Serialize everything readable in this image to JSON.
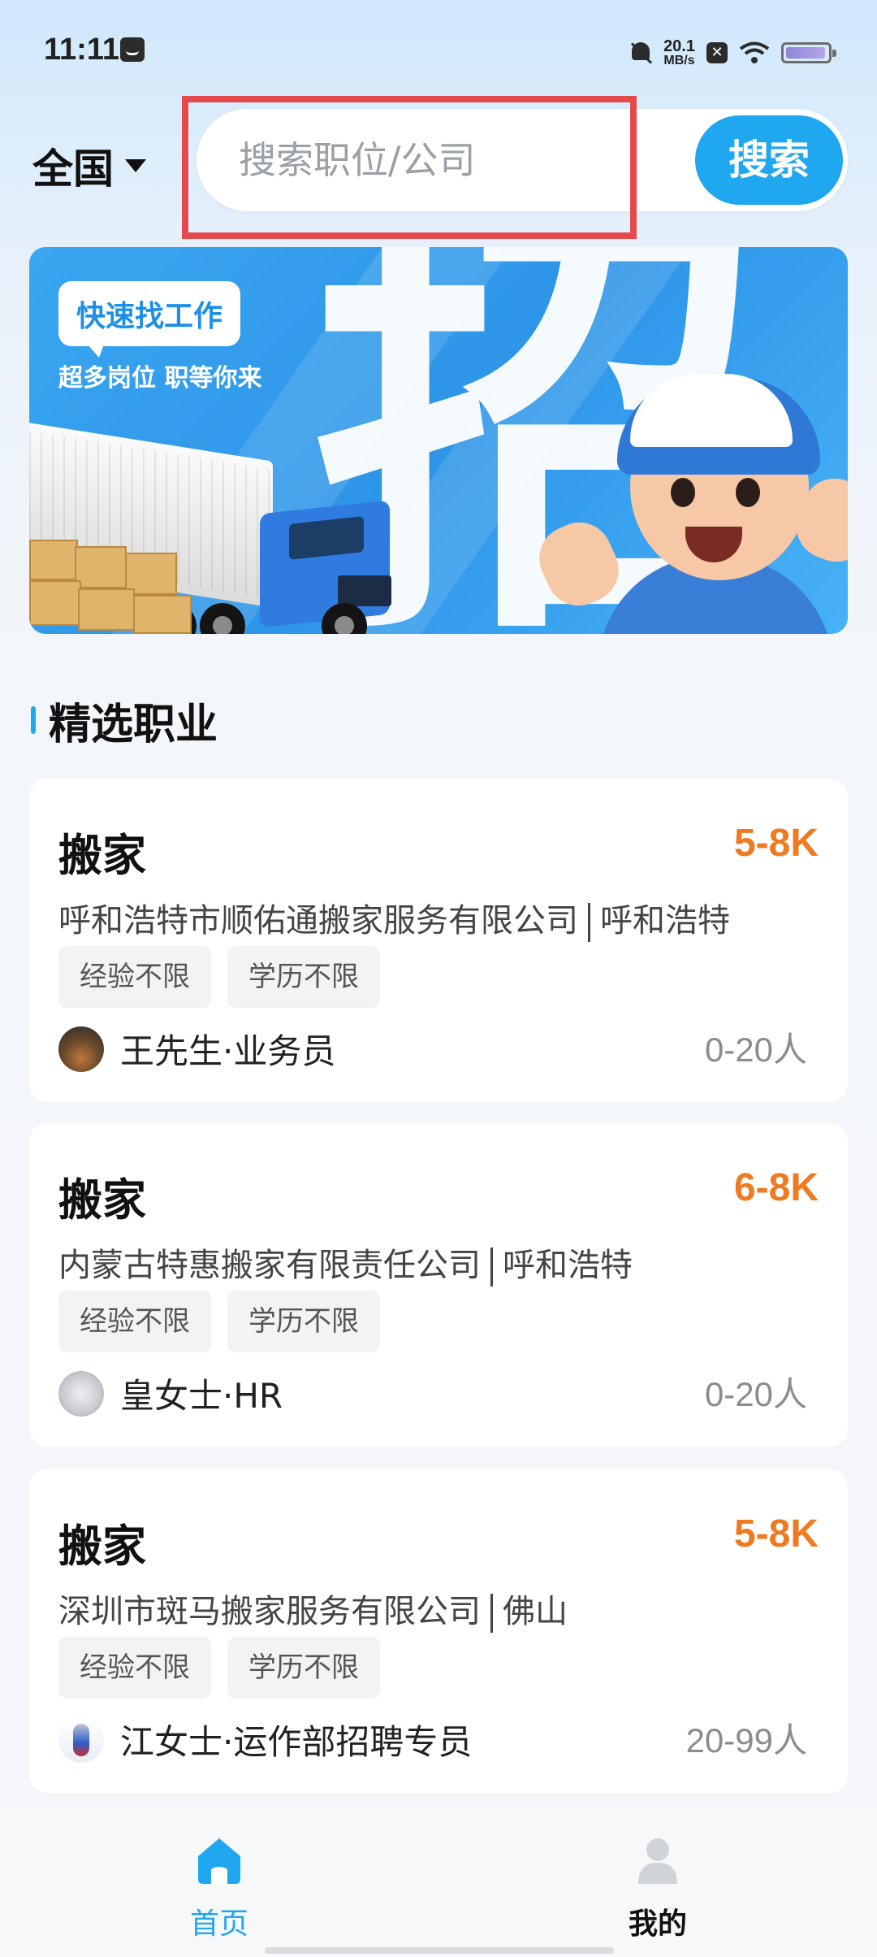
{
  "status_bar": {
    "time": "11:11",
    "net_speed_value": "20.1",
    "net_speed_unit": "MB/s",
    "icons": [
      "message-icon",
      "bell-muted-icon",
      "close-box-icon",
      "wifi-icon",
      "battery-icon"
    ],
    "x_box_label": "✕"
  },
  "header": {
    "location_label": "全国",
    "search_placeholder": "搜索职位/公司",
    "search_button_label": "搜索"
  },
  "banner": {
    "tag": "快速找工作",
    "subtitle": "超多岗位 职等你来",
    "big_char": "招"
  },
  "section": {
    "title": "精选职业"
  },
  "jobs": [
    {
      "title": "搬家",
      "salary": "5-8K",
      "company": "呼和浩特市顺佑通搬家服务有限公司",
      "city": "呼和浩特",
      "tags": [
        "经验不限",
        "学历不限"
      ],
      "recruiter": "王先生·业务员",
      "company_size": "0-20人"
    },
    {
      "title": "搬家",
      "salary": "6-8K",
      "company": "内蒙古特惠搬家有限责任公司",
      "city": "呼和浩特",
      "tags": [
        "经验不限",
        "学历不限"
      ],
      "recruiter": "皇女士·HR",
      "company_size": "0-20人"
    },
    {
      "title": "搬家",
      "salary": "5-8K",
      "company": "深圳市斑马搬家服务有限公司",
      "city": "佛山",
      "tags": [
        "经验不限",
        "学历不限"
      ],
      "recruiter": "江女士·运作部招聘专员",
      "company_size": "20-99人"
    }
  ],
  "bottom_nav": {
    "items": [
      {
        "label": "首页",
        "icon": "home-icon",
        "active": true
      },
      {
        "label": "我的",
        "icon": "user-icon",
        "active": false
      }
    ]
  },
  "colors": {
    "accent": "#1fa7ef",
    "salary": "#ee7a22",
    "highlight": "#e4494c"
  }
}
